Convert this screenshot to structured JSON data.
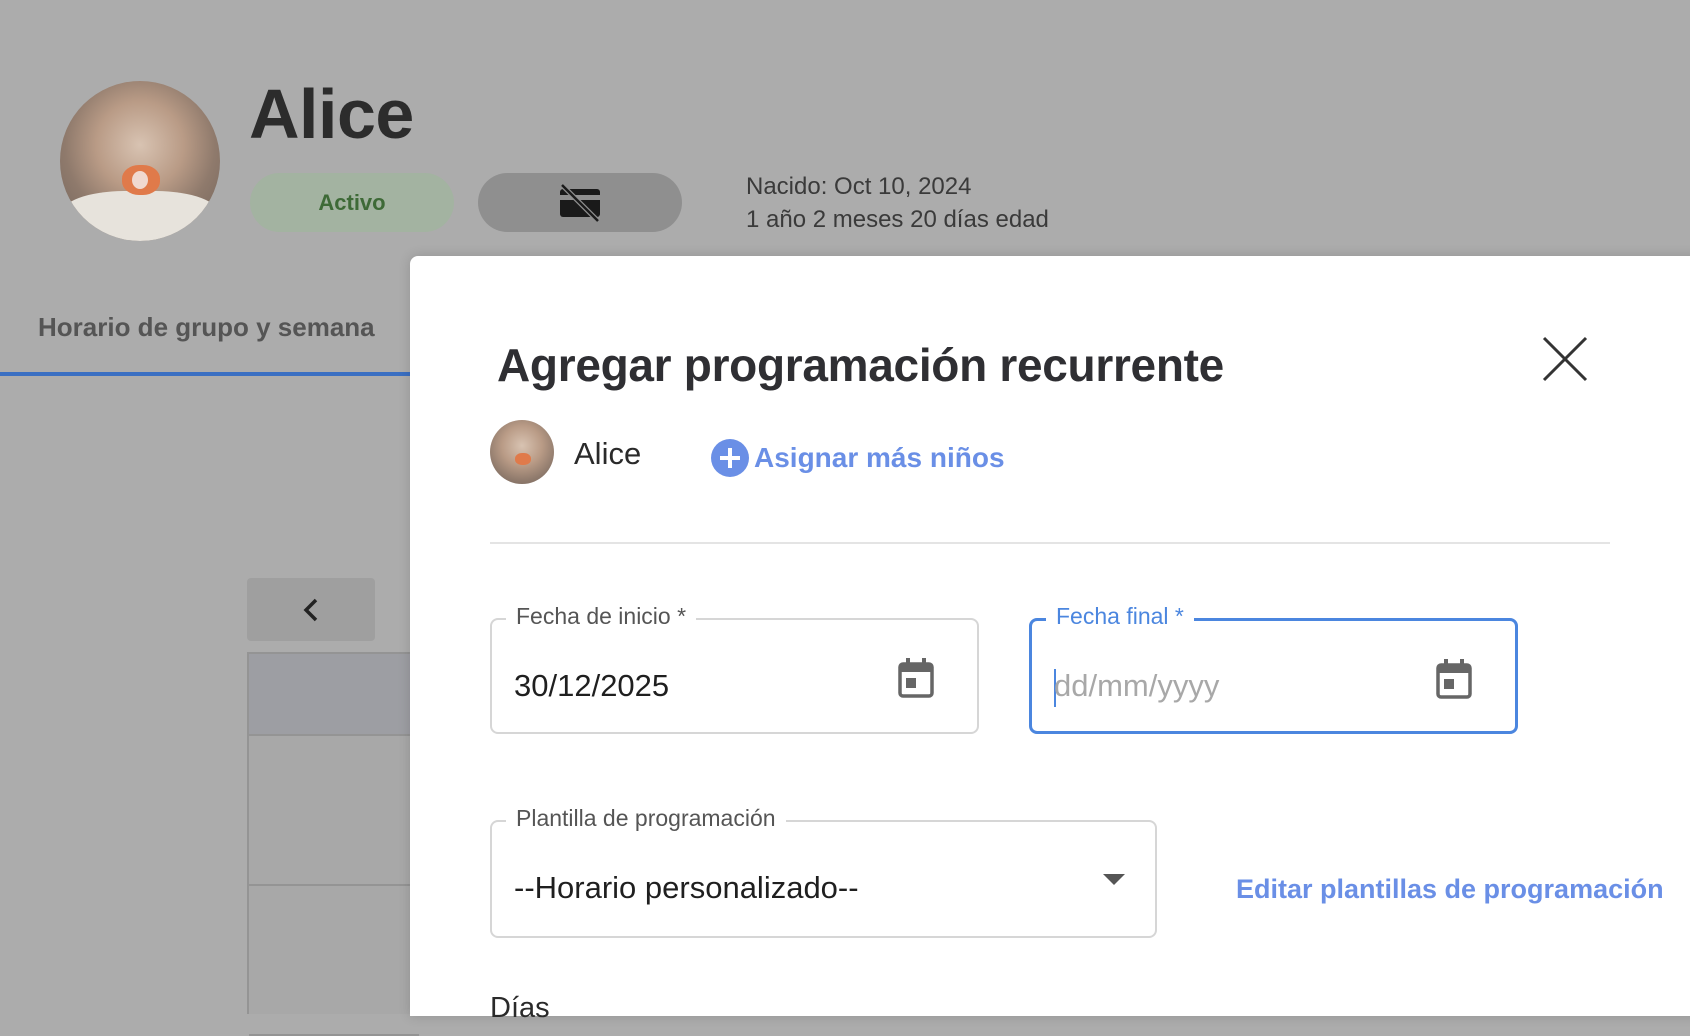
{
  "profile": {
    "name": "Alice",
    "status_label": "Activo",
    "born_label": "Nacido: Oct 10, 2024",
    "age_label": "1 año 2 meses 20 días edad"
  },
  "tabs": {
    "active_label": "Horario de grupo y semana"
  },
  "modal": {
    "title": "Agregar programación recurrente",
    "child_name": "Alice",
    "assign_label": "Asignar más niños",
    "start_date": {
      "label": "Fecha de inicio *",
      "value": "30/12/2025"
    },
    "end_date": {
      "label": "Fecha final *",
      "placeholder": "dd/mm/yyyy"
    },
    "template": {
      "label": "Plantilla de programación",
      "value": "--Horario personalizado--"
    },
    "edit_templates_label": "Editar plantillas de programación",
    "days_label": "Días"
  },
  "colors": {
    "accent": "#4b86df",
    "link": "#6a8fe6",
    "active_green": "#3e6a37"
  },
  "icons": [
    "no-card-icon",
    "chevron-left-icon",
    "close-icon",
    "plus-circle-icon",
    "calendar-icon",
    "dropdown-arrow-icon"
  ]
}
